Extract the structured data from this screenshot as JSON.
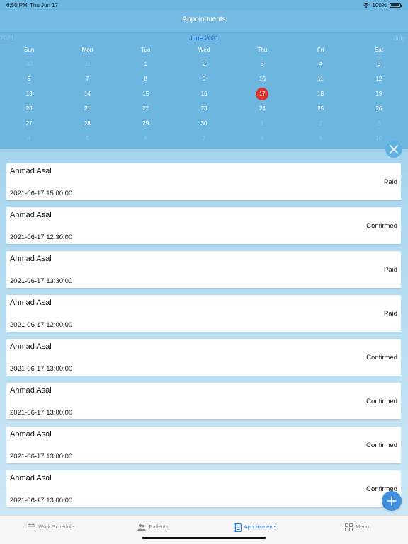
{
  "status_bar": {
    "time": "6:50 PM",
    "date": "Thu Jun 17",
    "battery": "100%"
  },
  "navbar": {
    "title": "Appointments"
  },
  "calendar": {
    "prev_label": "2021",
    "current_label": "June 2021",
    "next_label": "July",
    "weekdays": [
      "Sun",
      "Mon",
      "Tue",
      "Wed",
      "Thu",
      "Fri",
      "Sat"
    ],
    "weeks": [
      [
        "30",
        "31",
        "1",
        "2",
        "3",
        "4",
        "5"
      ],
      [
        "6",
        "7",
        "8",
        "9",
        "10",
        "11",
        "12"
      ],
      [
        "13",
        "14",
        "15",
        "16",
        "17",
        "18",
        "19"
      ],
      [
        "20",
        "21",
        "22",
        "23",
        "24",
        "25",
        "26"
      ],
      [
        "27",
        "28",
        "29",
        "30",
        "1",
        "2",
        "3"
      ],
      [
        "4",
        "5",
        "6",
        "7",
        "8",
        "9",
        "10"
      ]
    ],
    "selected_day": "17",
    "selected_color": "#d8342e"
  },
  "appointments": [
    {
      "name": "Ahmad Asal",
      "status": "Paid",
      "datetime": "2021-06-17 15:00:00"
    },
    {
      "name": "Ahmad Asal",
      "status": "Confirmed",
      "datetime": "2021-06-17 12:30:00"
    },
    {
      "name": "Ahmad Asal",
      "status": "Paid",
      "datetime": "2021-06-17 13:30:00"
    },
    {
      "name": "Ahmad Asal",
      "status": "Paid",
      "datetime": "2021-06-17 12:00:00"
    },
    {
      "name": "Ahmad Asal",
      "status": "Confirmed",
      "datetime": "2021-06-17 13:00:00"
    },
    {
      "name": "Ahmad Asal",
      "status": "Confirmed",
      "datetime": "2021-06-17 13:00:00"
    },
    {
      "name": "Ahmad Asal",
      "status": "Confirmed",
      "datetime": "2021-06-17 13:00:00"
    },
    {
      "name": "Ahmad Asal",
      "status": "Confirmed",
      "datetime": "2021-06-17 13:00:00"
    }
  ],
  "tabs": [
    {
      "label": "Work Schedule",
      "icon": "calendar-icon",
      "active": false
    },
    {
      "label": "Patients",
      "icon": "patients-icon",
      "active": false
    },
    {
      "label": "Appointments",
      "icon": "appointments-icon",
      "active": true
    },
    {
      "label": "Menu",
      "icon": "grid-menu-icon",
      "active": false
    }
  ],
  "colors": {
    "accent": "#2f7ee3",
    "header": "#6db6e0",
    "fab": "#3f8fdc"
  }
}
